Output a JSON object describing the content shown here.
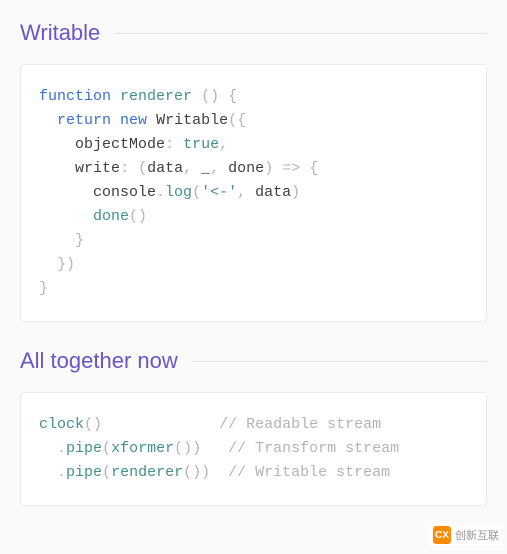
{
  "sections": {
    "writable": {
      "title": "Writable",
      "code": {
        "kw_function": "function",
        "fn_name": "renderer",
        "kw_return": "return",
        "kw_new": "new",
        "class_name": "Writable",
        "opt_objectMode": "objectMode",
        "bool_true": "true",
        "opt_write": "write",
        "param_data": "data",
        "param_underscore": "_",
        "param_done": "done",
        "call_console": "console",
        "call_log": "log",
        "str_arrow": "'<-'",
        "arg_data": "data",
        "call_done": "done"
      }
    },
    "together": {
      "title": "All together now",
      "code": {
        "call_clock": "clock",
        "call_pipe1": "pipe",
        "call_xformer": "xformer",
        "call_pipe2": "pipe",
        "call_renderer": "renderer",
        "comment_readable": "// Readable stream",
        "comment_transform": "// Transform stream",
        "comment_writable": "// Writable stream"
      }
    }
  },
  "watermark": {
    "logo": "CX",
    "text": "创新互联"
  }
}
